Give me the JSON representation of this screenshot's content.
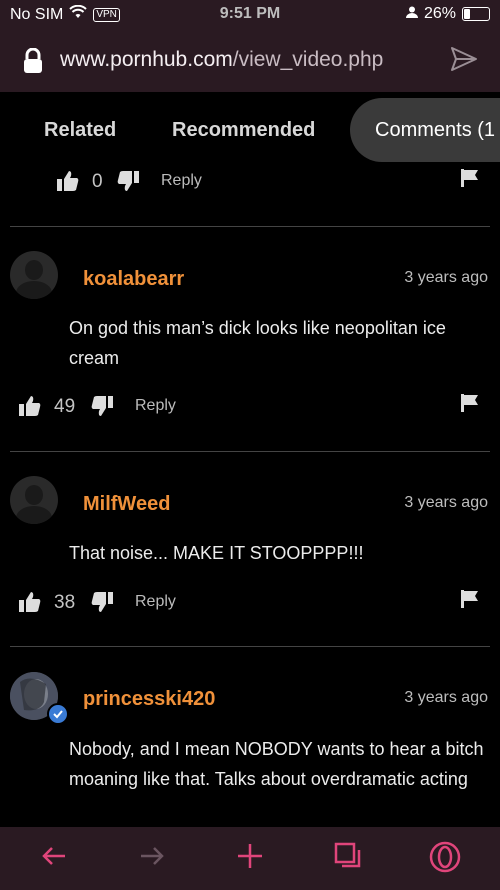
{
  "status": {
    "carrier": "No SIM",
    "vpn": "VPN",
    "time": "9:51 PM",
    "battery": "26%"
  },
  "browser": {
    "url_domain": "www.pornhub.com",
    "url_path": "/view_video.php"
  },
  "tabs": {
    "related": "Related",
    "recommended": "Recommended",
    "comments": "Comments (1"
  },
  "prev_comment": {
    "likes": "0",
    "reply": "Reply"
  },
  "comments": [
    {
      "username": "koalabearr",
      "time": "3 years ago",
      "text": "On god this man’s dick looks like neopolitan ice cream",
      "likes": "49",
      "reply": "Reply"
    },
    {
      "username": "MilfWeed",
      "time": "3 years ago",
      "text": "That noise... MAKE IT STOOPPPP!!!",
      "likes": "38",
      "reply": "Reply"
    },
    {
      "username": "princesski420",
      "time": "3 years ago",
      "text": "Nobody, and I mean NOBODY wants to hear a bitch moaning like that. Talks about overdramatic acting"
    }
  ],
  "colors": {
    "username": "#f0913a",
    "bars": "#2a1a22",
    "accent": "#e0457b"
  }
}
